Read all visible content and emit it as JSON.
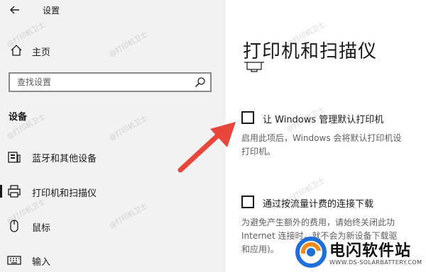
{
  "window": {
    "title": "设置"
  },
  "sidebar": {
    "home_label": "主页",
    "search_placeholder": "查找设置",
    "section_heading": "设备",
    "items": [
      {
        "label": "蓝牙和其他设备",
        "icon": "keyboard-icon",
        "selected": false
      },
      {
        "label": "打印机和扫描仪",
        "icon": "printer-icon",
        "selected": true
      },
      {
        "label": "鼠标",
        "icon": "mouse-icon",
        "selected": false
      },
      {
        "label": "输入",
        "icon": "keyboard-icon",
        "selected": false
      }
    ]
  },
  "main": {
    "title": "打印机和扫描仪",
    "default_printer": {
      "label": "让 Windows 管理默认打印机",
      "checked": false,
      "desc_line1": "启用此项后，Windows 会将默认打印机设",
      "desc_line2": "打印机。"
    },
    "metered": {
      "label": "通过按流量计费的连接下载",
      "checked": false,
      "desc_line1": "为避免产生额外的费用，请始终关闭此功",
      "desc_line2": "Internet 连接时，就不会为新设备下载驱",
      "desc_line3": "和应用)。"
    }
  },
  "watermark": {
    "text": "@打印机卫士"
  },
  "brand": {
    "name": "电闪软件站",
    "url": "WWW.DS-SOLARBATTERY.COM"
  },
  "colors": {
    "arrow": "#e8463a",
    "sidebar_bg": "#f2f2f2",
    "brand_orange": "#f08a1c",
    "brand_blue": "#1e6fd9"
  }
}
